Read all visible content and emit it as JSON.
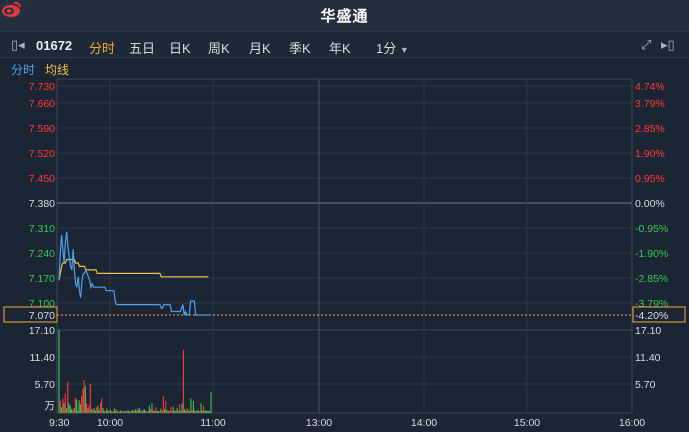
{
  "app": {
    "brand": "华盛通"
  },
  "toolbar": {
    "code": "01672",
    "tabs": [
      "分时",
      "五日",
      "日K",
      "周K",
      "月K",
      "季K",
      "年K"
    ],
    "active_tab": "分时",
    "interval": "1分"
  },
  "legend": {
    "timeshare": "分时",
    "avg": "均线"
  },
  "colors": {
    "up": "#ff3b3b",
    "down": "#33cc55",
    "neutral": "#d8dde4",
    "price_line": "#4ea1f0",
    "avg_line": "#f2c04a",
    "current_box": "#f2a93b"
  },
  "chart_data": {
    "type": "line",
    "price_axis_left": [
      "7.730",
      "7.660",
      "7.590",
      "7.520",
      "7.450",
      "7.380",
      "7.310",
      "7.240",
      "7.170",
      "7.100",
      "7.070"
    ],
    "price_axis_right": [
      "4.74%",
      "3.79%",
      "2.85%",
      "1.90%",
      "0.95%",
      "0.00%",
      "-0.95%",
      "-1.90%",
      "-2.85%",
      "-3.79%",
      "-4.20%"
    ],
    "ylim": [
      7.03,
      7.73
    ],
    "prev_close": 7.38,
    "current_price": 7.07,
    "current_pct": "-4.20%",
    "volume_axis": [
      "17.10",
      "11.40",
      "5.70",
      "万"
    ],
    "time_labels": [
      "9:30",
      "10:00",
      "11:00",
      "13:00",
      "14:00",
      "15:00",
      "16:00"
    ],
    "price_series": [
      7.17,
      7.25,
      7.3,
      7.26,
      7.22,
      7.28,
      7.31,
      7.27,
      7.24,
      7.21,
      7.2,
      7.26,
      7.2,
      7.16,
      7.15,
      7.18,
      7.14,
      7.12,
      7.17,
      7.19,
      7.19,
      7.2,
      7.19,
      7.18,
      7.17,
      7.15,
      7.16,
      7.15,
      7.15,
      7.15,
      7.15,
      7.15,
      7.15,
      7.15,
      7.15,
      7.15,
      7.15,
      7.14,
      7.14,
      7.14,
      7.14,
      7.14,
      7.14,
      7.14,
      7.11,
      7.1,
      7.1,
      7.1,
      7.1,
      7.1,
      7.1,
      7.1,
      7.1,
      7.1,
      7.1,
      7.1,
      7.1,
      7.1,
      7.1,
      7.1,
      7.1,
      7.1,
      7.1,
      7.1,
      7.1,
      7.1,
      7.1,
      7.1,
      7.1,
      7.1,
      7.1,
      7.1,
      7.1,
      7.1,
      7.1,
      7.1,
      7.1,
      7.1,
      7.1,
      7.1,
      7.09,
      7.09,
      7.1,
      7.1,
      7.1,
      7.1,
      7.1,
      7.1,
      7.08,
      7.08,
      7.08,
      7.08,
      7.08,
      7.08,
      7.08,
      7.08,
      7.09,
      7.1,
      7.07,
      7.08,
      7.07,
      7.07,
      7.07,
      7.11,
      7.11,
      7.11,
      7.11,
      7.07,
      7.07,
      7.07,
      7.07,
      7.07,
      7.07,
      7.07,
      7.07,
      7.07,
      7.07,
      7.07,
      7.07,
      7.07
    ],
    "avg_series": [
      7.17,
      7.19,
      7.21,
      7.22,
      7.22,
      7.22,
      7.23,
      7.23,
      7.23,
      7.23,
      7.23,
      7.23,
      7.23,
      7.22,
      7.22,
      7.22,
      7.21,
      7.21,
      7.21,
      7.21,
      7.21,
      7.2,
      7.2,
      7.2,
      7.2,
      7.2,
      7.2,
      7.2,
      7.2,
      7.2,
      7.19,
      7.19,
      7.19,
      7.19,
      7.19,
      7.19,
      7.19,
      7.19,
      7.19,
      7.19,
      7.19,
      7.19,
      7.19,
      7.19,
      7.19,
      7.19,
      7.19,
      7.19,
      7.19,
      7.19,
      7.19,
      7.19,
      7.19,
      7.19,
      7.19,
      7.19,
      7.19,
      7.19,
      7.19,
      7.19,
      7.19,
      7.19,
      7.19,
      7.19,
      7.19,
      7.19,
      7.19,
      7.19,
      7.19,
      7.19,
      7.19,
      7.19,
      7.19,
      7.19,
      7.19,
      7.19,
      7.19,
      7.19,
      7.19,
      7.19,
      7.18,
      7.18,
      7.18,
      7.18,
      7.18,
      7.18,
      7.18,
      7.18,
      7.18,
      7.18,
      7.18,
      7.18,
      7.18,
      7.18,
      7.18,
      7.18,
      7.18,
      7.18,
      7.18,
      7.18,
      7.18,
      7.18,
      7.18,
      7.18,
      7.18,
      7.18,
      7.18,
      7.18,
      7.18,
      7.18,
      7.18,
      7.18,
      7.18,
      7.18,
      7.18,
      7.18,
      7.18,
      7.18
    ],
    "volume_max": 17.1,
    "volume_series": [
      17.1,
      2.5,
      1.2,
      3.0,
      2.0,
      4.0,
      1.0,
      6.5,
      2.0,
      1.5,
      0.8,
      0.6,
      1.0,
      3.2,
      2.8,
      0.5,
      2.6,
      1.8,
      3.5,
      5.0,
      6.8,
      5.5,
      2.0,
      1.0,
      1.6,
      6.0,
      0.8,
      0.7,
      1.0,
      0.5,
      1.2,
      1.5,
      0.6,
      2.0,
      3.0,
      1.0,
      0.4,
      0.3,
      0.9,
      0.5,
      0.6,
      0.7,
      0.3,
      0.4,
      1.0,
      0.5,
      0.8,
      0.3,
      0.4,
      0.6,
      0.3,
      0.5,
      0.4,
      0.3,
      0.6,
      0.5,
      0.4,
      0.3,
      0.5,
      0.6,
      0.4,
      0.8,
      0.5,
      0.9,
      1.0,
      0.5,
      0.4,
      0.6,
      0.7,
      0.5,
      0.3,
      0.4,
      1.5,
      0.8,
      2.0,
      0.6,
      0.4,
      1.2,
      0.5,
      0.4,
      0.3,
      0.9,
      0.5,
      3.5,
      0.8,
      2.5,
      0.6,
      0.4,
      0.5,
      1.2,
      0.5,
      1.3,
      0.4,
      0.6,
      1.0,
      0.4,
      1.8,
      0.5,
      2.0,
      13.0,
      0.8,
      0.5,
      1.0,
      0.7,
      0.4,
      3.0,
      0.6,
      2.5,
      0.5,
      0.4,
      0.6,
      0.5,
      0.4,
      2.0,
      0.5,
      1.5,
      0.5,
      0.6,
      0.4,
      0.3,
      0.5,
      4.3
    ],
    "volume_colors": [
      "g",
      "r",
      "g",
      "r",
      "g",
      "r",
      "g",
      "r",
      "g",
      "g",
      "g",
      "r",
      "g",
      "r",
      "g",
      "g",
      "g",
      "g",
      "r",
      "r",
      "r",
      "g",
      "r",
      "g",
      "r",
      "r",
      "g",
      "r",
      "g",
      "g",
      "r",
      "g",
      "g",
      "r",
      "r",
      "g",
      "g",
      "r",
      "g",
      "g",
      "r",
      "g",
      "g",
      "r",
      "g",
      "g",
      "r",
      "g",
      "r",
      "g",
      "g",
      "r",
      "g",
      "g",
      "r",
      "g",
      "g",
      "r",
      "g",
      "g",
      "r",
      "g",
      "g",
      "r",
      "g",
      "g",
      "r",
      "g",
      "g",
      "r",
      "g",
      "r",
      "g",
      "r",
      "g",
      "r",
      "g",
      "r",
      "g",
      "g",
      "r",
      "g",
      "r",
      "r",
      "g",
      "r",
      "g",
      "g",
      "r",
      "r",
      "r",
      "g",
      "g",
      "r",
      "g",
      "g",
      "r",
      "g",
      "g",
      "r",
      "g",
      "g",
      "r",
      "r",
      "g",
      "g",
      "r",
      "g",
      "g",
      "r",
      "g",
      "g",
      "r",
      "g",
      "g",
      "r",
      "g",
      "g",
      "g",
      "g",
      "g"
    ]
  }
}
